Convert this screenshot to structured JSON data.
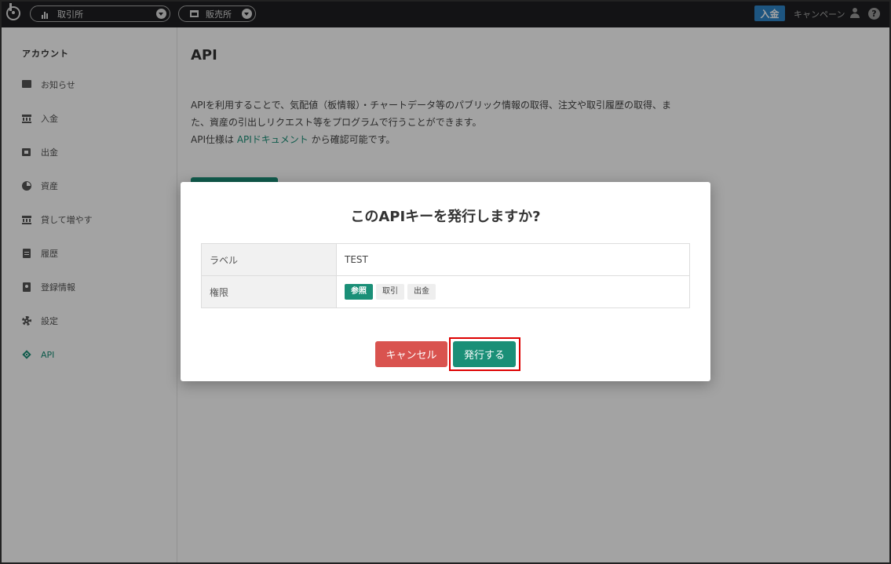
{
  "topbar": {
    "exchange_label": "取引所",
    "sales_label": "販売所",
    "deposit_label": "入金",
    "campaign_label": "キャンペーン",
    "help_glyph": "?"
  },
  "sidebar": {
    "heading": "アカウント",
    "items": [
      {
        "label": "お知らせ",
        "icon": "message-icon"
      },
      {
        "label": "入金",
        "icon": "bank-icon"
      },
      {
        "label": "出金",
        "icon": "wallet-icon"
      },
      {
        "label": "資産",
        "icon": "pie-chart-icon"
      },
      {
        "label": "貸して増やす",
        "icon": "bank-icon"
      },
      {
        "label": "履歴",
        "icon": "clipboard-icon"
      },
      {
        "label": "登録情報",
        "icon": "id-card-icon"
      },
      {
        "label": "設定",
        "icon": "gear-icon"
      },
      {
        "label": "API",
        "icon": "api-icon",
        "active": true
      }
    ]
  },
  "main": {
    "title": "API",
    "desc_line1": "APIを利用することで、気配値（板情報）・チャートデータ等のパブリック情報の取得、注文や取引履歴の取得、ま",
    "desc_line2": "た、資産の引出しリクエスト等をプログラムで行うことができます。",
    "desc_line3_prefix": "API仕様は ",
    "desc_link": "APIドキュメント",
    "desc_line3_suffix": " から確認可能です。"
  },
  "modal": {
    "title": "このAPIキーを発行しますか?",
    "label_header": "ラベル",
    "label_value": "TEST",
    "permission_header": "権限",
    "permissions": [
      {
        "label": "参照",
        "active": true
      },
      {
        "label": "取引",
        "active": false
      },
      {
        "label": "出金",
        "active": false
      }
    ],
    "cancel_label": "キャンセル",
    "issue_label": "発行する"
  },
  "colors": {
    "accent": "#1a8f77",
    "danger": "#d9534f",
    "deposit_blue": "#2e86c8",
    "topbar": "#1e1f21"
  }
}
